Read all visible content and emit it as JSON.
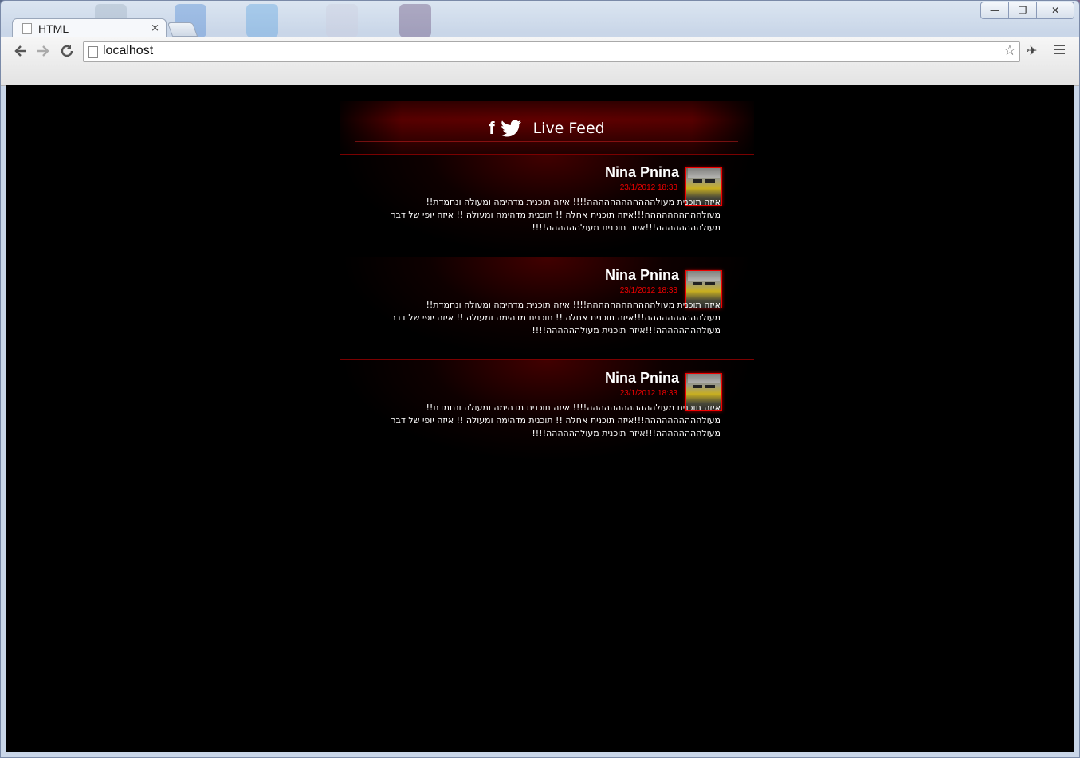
{
  "browser": {
    "tab_title": "HTML",
    "tab_close": "×",
    "address": "localhost",
    "icons": {
      "back": "back-arrow-icon",
      "forward": "forward-arrow-icon",
      "reload": "reload-icon",
      "star": "bookmark-star-icon",
      "extension": "extension-icon",
      "menu": "menu-icon"
    },
    "window_controls": {
      "minimize": "—",
      "maximize": "❐",
      "close": "✕"
    }
  },
  "feed": {
    "title": "Live Feed",
    "social_icons": [
      "facebook-icon",
      "twitter-icon"
    ],
    "posts": [
      {
        "name": "Nina Pnina",
        "date": "23/1/2012 18:33",
        "text": "איזה תוכנית מעולהההההההההההה!!!! איזה תוכנית מדהימה ומעולה ונחמדת!! מעולהההההההההה!!!איזה תוכנית אחלה !! תוכנית מדהימה ומעולה !! איזה יופי של דבר מעולהההההההה!!!איזה תוכנית מעולהההההה!!!!"
      },
      {
        "name": "Nina Pnina",
        "date": "23/1/2012 18:33",
        "text": "איזה תוכנית מעולהההההההההההה!!!! איזה תוכנית מדהימה ומעולה ונחמדת!! מעולהההההההההה!!!איזה תוכנית אחלה !! תוכנית מדהימה ומעולה !! איזה יופי של דבר מעולהההההההה!!!איזה תוכנית מעולהההההה!!!!"
      },
      {
        "name": "Nina Pnina",
        "date": "23/1/2012 18:33",
        "text": "איזה תוכנית מעולהההההההההההה!!!! איזה תוכנית מדהימה ומעולה ונחמדת!! מעולהההההההההה!!!איזה תוכנית אחלה !! תוכנית מדהימה ומעולה !! איזה יופי של דבר מעולהההההההה!!!איזה תוכנית מעולהההההה!!!!"
      }
    ]
  },
  "colors": {
    "accent_red": "#ee0000",
    "background": "#000000",
    "text": "#ffffff"
  }
}
